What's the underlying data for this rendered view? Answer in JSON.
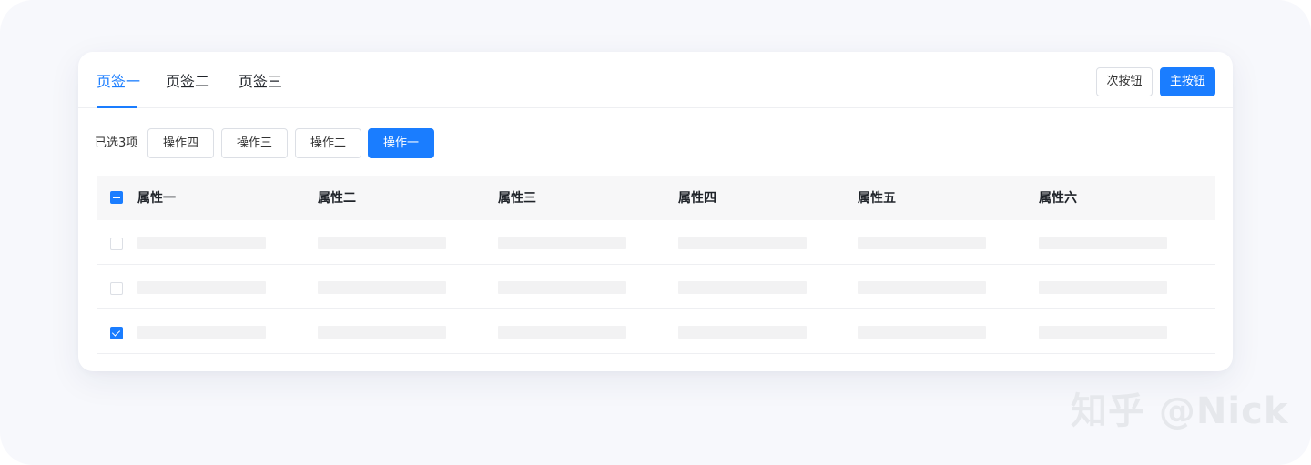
{
  "tabs": [
    {
      "label": "页签一",
      "active": true
    },
    {
      "label": "页签二",
      "active": false
    },
    {
      "label": "页签三",
      "active": false
    }
  ],
  "header_buttons": {
    "secondary_label": "次按钮",
    "primary_label": "主按钮"
  },
  "toolbar": {
    "selected_text": "已选3项",
    "operations": [
      "操作四",
      "操作三",
      "操作二",
      "操作一"
    ],
    "primary_operation": "操作一"
  },
  "table": {
    "columns": [
      "属性一",
      "属性二",
      "属性三",
      "属性四",
      "属性五",
      "属性六"
    ],
    "header_checkbox_state": "indeterminate",
    "rows": [
      {
        "checked": false
      },
      {
        "checked": false
      },
      {
        "checked": true
      }
    ]
  },
  "watermark": "知乎 @Nick",
  "colors": {
    "accent": "#1a7dff",
    "background": "#f7f8fc",
    "skeleton": "#f2f2f3"
  }
}
